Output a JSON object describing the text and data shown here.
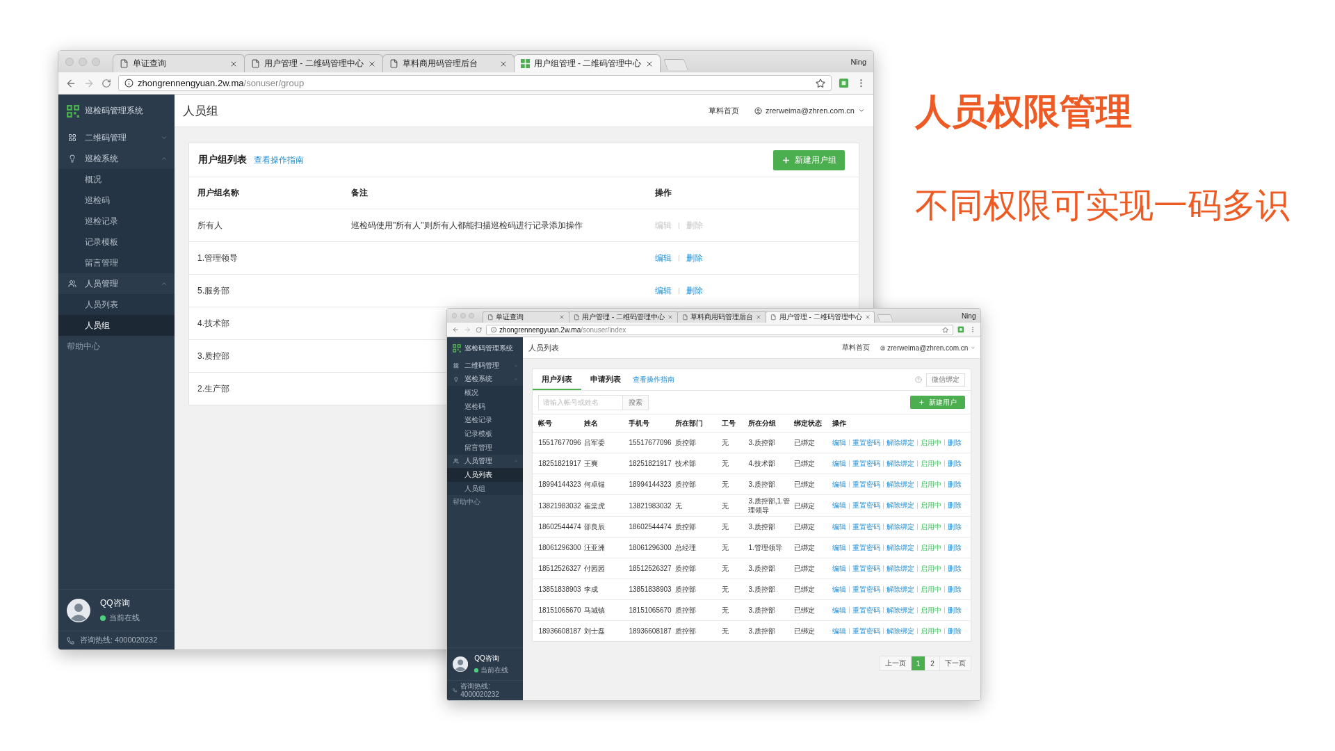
{
  "headline": "人员权限管理",
  "tagline": "不同权限可实现一码多识",
  "back_window": {
    "browser": {
      "tabs": [
        {
          "title": "单证查询",
          "kind": "page",
          "selected": false
        },
        {
          "title": "用户管理 - 二维码管理中心",
          "kind": "page",
          "selected": false
        },
        {
          "title": "草料商用码管理后台",
          "kind": "page",
          "selected": false
        },
        {
          "title": "用户组管理 - 二维码管理中心",
          "kind": "app",
          "selected": true
        }
      ],
      "profile": "Ning",
      "url_host": "zhongrennengyuan.2w.ma",
      "url_path": "/sonuser/group"
    },
    "sidebar": {
      "brand": "巡检码管理系统",
      "nav": [
        {
          "label": "二维码管理",
          "expanded": false
        },
        {
          "label": "巡检系统",
          "expanded": true,
          "children": [
            {
              "label": "概况",
              "selected": false
            },
            {
              "label": "巡检码",
              "selected": false
            },
            {
              "label": "巡检记录",
              "selected": false
            },
            {
              "label": "记录模板",
              "selected": false
            },
            {
              "label": "留言管理",
              "selected": false
            }
          ]
        },
        {
          "label": "人员管理",
          "expanded": true,
          "children": [
            {
              "label": "人员列表",
              "selected": false
            },
            {
              "label": "人员组",
              "selected": true
            }
          ]
        }
      ],
      "help": "帮助中心",
      "support": {
        "name": "QQ咨询",
        "status": "当前在线",
        "hotline": "咨询热线: 4000020232"
      }
    },
    "header": {
      "title": "人员组",
      "home_link": "草料首页",
      "account": "zrerweima@zhren.com.cn"
    },
    "card": {
      "title": "用户组列表",
      "guide_link": "查看操作指南",
      "new_button": "新建用户组",
      "columns": [
        "用户组名称",
        "备注",
        "操作"
      ],
      "rows": [
        {
          "name": "所有人",
          "note": "巡检码使用\"所有人\"则所有人都能扫描巡检码进行记录添加操作",
          "actions": [
            {
              "label": "编辑",
              "disabled": true
            },
            {
              "label": "删除",
              "disabled": true
            }
          ]
        },
        {
          "name": "1.管理领导",
          "actions": [
            {
              "label": "编辑",
              "disabled": false
            },
            {
              "label": "删除",
              "disabled": false
            }
          ]
        },
        {
          "name": "5.服务部",
          "actions": [
            {
              "label": "编辑",
              "disabled": false
            },
            {
              "label": "删除",
              "disabled": false
            }
          ]
        },
        {
          "name": "4.技术部"
        },
        {
          "name": "3.质控部"
        },
        {
          "name": "2.生产部"
        }
      ]
    }
  },
  "front_window": {
    "browser": {
      "tabs": [
        {
          "title": "单证查询",
          "kind": "page",
          "selected": false
        },
        {
          "title": "用户管理 - 二维码管理中心",
          "kind": "page",
          "selected": false
        },
        {
          "title": "草料商用码管理后台",
          "kind": "page",
          "selected": false
        },
        {
          "title": "用户管理 - 二维码管理中心",
          "kind": "page",
          "selected": true
        }
      ],
      "profile": "Ning",
      "url_host": "zhongrennengyuan.2w.ma",
      "url_path": "/sonuser/index"
    },
    "sidebar": {
      "brand": "巡检码管理系统",
      "nav": [
        {
          "label": "二维码管理",
          "expanded": false
        },
        {
          "label": "巡检系统",
          "expanded": true,
          "children": [
            {
              "label": "概况",
              "selected": false
            },
            {
              "label": "巡检码",
              "selected": false
            },
            {
              "label": "巡检记录",
              "selected": false
            },
            {
              "label": "记录模板",
              "selected": false
            },
            {
              "label": "留言管理",
              "selected": false
            }
          ]
        },
        {
          "label": "人员管理",
          "expanded": true,
          "children": [
            {
              "label": "人员列表",
              "selected": true
            },
            {
              "label": "人员组",
              "selected": false
            }
          ]
        }
      ],
      "help": "帮助中心",
      "support": {
        "name": "QQ咨询",
        "status": "当前在线",
        "hotline": "咨询热线: 4000020232"
      }
    },
    "header": {
      "title": "人员列表",
      "home_link": "草料首页",
      "account": "zrerweima@zhren.com.cn"
    },
    "card": {
      "tabs": [
        {
          "label": "用户列表",
          "selected": true
        },
        {
          "label": "申请列表",
          "selected": false
        }
      ],
      "guide_link": "查看操作指南",
      "bind_button": "微信绑定",
      "search": {
        "placeholder": "请输入帐号或姓名",
        "button": "搜索"
      },
      "new_button": "新建用户",
      "columns": [
        "帐号",
        "姓名",
        "手机号",
        "所在部门",
        "工号",
        "所在分组",
        "绑定状态",
        "操作"
      ],
      "rows": [
        {
          "cells": [
            "15517677096",
            "吕军委",
            "15517677096",
            "质控部",
            "无",
            "3.质控部",
            "已绑定"
          ],
          "actions": [
            {
              "label": "编辑",
              "kind": "link"
            },
            {
              "label": "重置密码",
              "kind": "link"
            },
            {
              "label": "解除绑定",
              "kind": "link"
            },
            {
              "label": "启用中",
              "kind": "status"
            },
            {
              "label": "删除",
              "kind": "link"
            }
          ]
        },
        {
          "cells": [
            "18251821917",
            "王爽",
            "18251821917",
            "技术部",
            "无",
            "4.技术部",
            "已绑定"
          ],
          "actions": [
            {
              "label": "编辑",
              "kind": "link"
            },
            {
              "label": "重置密码",
              "kind": "link"
            },
            {
              "label": "解除绑定",
              "kind": "link"
            },
            {
              "label": "启用中",
              "kind": "status"
            },
            {
              "label": "删除",
              "kind": "link"
            }
          ]
        },
        {
          "cells": [
            "18994144323",
            "何卓锚",
            "18994144323",
            "质控部",
            "无",
            "3.质控部",
            "已绑定"
          ],
          "actions": [
            {
              "label": "编辑",
              "kind": "link"
            },
            {
              "label": "重置密码",
              "kind": "link"
            },
            {
              "label": "解除绑定",
              "kind": "link"
            },
            {
              "label": "启用中",
              "kind": "status"
            },
            {
              "label": "删除",
              "kind": "link"
            }
          ]
        },
        {
          "cells": [
            "13821983032",
            "崔棠虎",
            "13821983032",
            "无",
            "无",
            "3.质控部,1.管理领导",
            "已绑定"
          ],
          "actions": [
            {
              "label": "编辑",
              "kind": "link"
            },
            {
              "label": "重置密码",
              "kind": "link"
            },
            {
              "label": "解除绑定",
              "kind": "link"
            },
            {
              "label": "启用中",
              "kind": "status"
            },
            {
              "label": "删除",
              "kind": "link"
            }
          ]
        },
        {
          "cells": [
            "18602544474",
            "邵良辰",
            "18602544474",
            "质控部",
            "无",
            "3.质控部",
            "已绑定"
          ],
          "actions": [
            {
              "label": "编辑",
              "kind": "link"
            },
            {
              "label": "重置密码",
              "kind": "link"
            },
            {
              "label": "解除绑定",
              "kind": "link"
            },
            {
              "label": "启用中",
              "kind": "status"
            },
            {
              "label": "删除",
              "kind": "link"
            }
          ]
        },
        {
          "cells": [
            "18061296300",
            "汪亚洲",
            "18061296300",
            "总经理",
            "无",
            "1.管理领导",
            "已绑定"
          ],
          "actions": [
            {
              "label": "编辑",
              "kind": "link"
            },
            {
              "label": "重置密码",
              "kind": "link"
            },
            {
              "label": "解除绑定",
              "kind": "link"
            },
            {
              "label": "启用中",
              "kind": "status"
            },
            {
              "label": "删除",
              "kind": "link"
            }
          ]
        },
        {
          "cells": [
            "18512526327",
            "付园园",
            "18512526327",
            "质控部",
            "无",
            "3.质控部",
            "已绑定"
          ],
          "actions": [
            {
              "label": "编辑",
              "kind": "link"
            },
            {
              "label": "重置密码",
              "kind": "link"
            },
            {
              "label": "解除绑定",
              "kind": "link"
            },
            {
              "label": "启用中",
              "kind": "status"
            },
            {
              "label": "删除",
              "kind": "link"
            }
          ]
        },
        {
          "cells": [
            "13851838903",
            "李成",
            "13851838903",
            "质控部",
            "无",
            "3.质控部",
            "已绑定"
          ],
          "actions": [
            {
              "label": "编辑",
              "kind": "link"
            },
            {
              "label": "重置密码",
              "kind": "link"
            },
            {
              "label": "解除绑定",
              "kind": "link"
            },
            {
              "label": "启用中",
              "kind": "status"
            },
            {
              "label": "删除",
              "kind": "link"
            }
          ]
        },
        {
          "cells": [
            "18151065670",
            "马城镇",
            "18151065670",
            "质控部",
            "无",
            "3.质控部",
            "已绑定"
          ],
          "actions": [
            {
              "label": "编辑",
              "kind": "link"
            },
            {
              "label": "重置密码",
              "kind": "link"
            },
            {
              "label": "解除绑定",
              "kind": "link"
            },
            {
              "label": "启用中",
              "kind": "status"
            },
            {
              "label": "删除",
              "kind": "link"
            }
          ]
        },
        {
          "cells": [
            "18936608187",
            "刘士磊",
            "18936608187",
            "质控部",
            "无",
            "3.质控部",
            "已绑定"
          ],
          "actions": [
            {
              "label": "编辑",
              "kind": "link"
            },
            {
              "label": "重置密码",
              "kind": "link"
            },
            {
              "label": "解除绑定",
              "kind": "link"
            },
            {
              "label": "启用中",
              "kind": "status"
            },
            {
              "label": "删除",
              "kind": "link"
            }
          ]
        }
      ],
      "pagination": {
        "prev": "上一页",
        "pages": [
          {
            "label": "1",
            "selected": true
          },
          {
            "label": "2",
            "selected": false
          }
        ],
        "next": "下一页"
      }
    }
  }
}
